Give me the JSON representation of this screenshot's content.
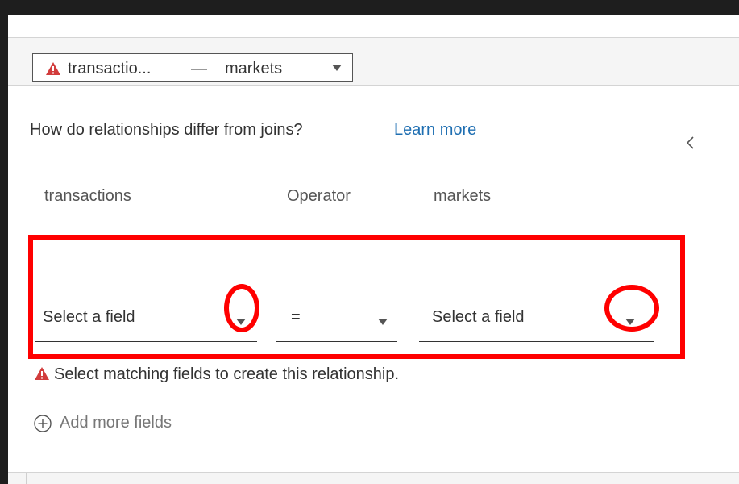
{
  "relationship_selector": {
    "left_table": "transactio...",
    "separator": "—",
    "right_table": "markets",
    "warning_icon": "warning-triangle-icon",
    "dropdown_icon": "caret-down-icon"
  },
  "panel": {
    "collapse_icon": "chevron-left-icon"
  },
  "help": {
    "question": "How do relationships differ from joins?",
    "link": "Learn more"
  },
  "fields": {
    "left_header": "transactions",
    "operator_header": "Operator",
    "right_header": "markets",
    "left_value": "Select a field",
    "operator_value": "=",
    "right_value": "Select a field"
  },
  "error": {
    "icon": "warning-triangle-icon",
    "text": "Select matching fields to create this relationship."
  },
  "add_more": {
    "icon": "plus-circle-icon",
    "label": "Add more fields"
  },
  "colors": {
    "warning": "#d23c3c",
    "link": "#1f6fb2",
    "highlight": "#ff0000"
  }
}
